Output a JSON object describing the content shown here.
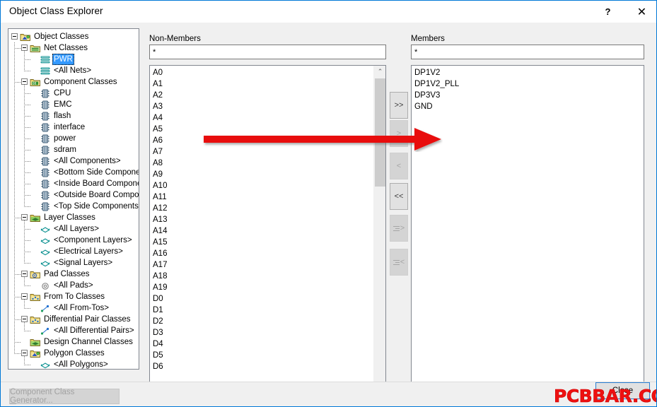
{
  "window": {
    "title": "Object Class Explorer",
    "help_label": "?",
    "close_label": "✕"
  },
  "tree": {
    "name": "object-class-tree",
    "nodes": [
      {
        "label": "Object Classes",
        "depth": 0,
        "icon": "polygon-classes-icon",
        "expander": "minus",
        "selected": false
      },
      {
        "label": "Net Classes",
        "depth": 1,
        "icon": "net-classes-folder-icon",
        "expander": "minus",
        "selected": false
      },
      {
        "label": "PWR",
        "depth": 2,
        "icon": "net-class-icon",
        "expander": "none",
        "selected": true
      },
      {
        "label": "<All Nets>",
        "depth": 2,
        "icon": "net-class-icon",
        "expander": "none",
        "selected": false
      },
      {
        "label": "Component Classes",
        "depth": 1,
        "icon": "component-classes-folder-icon",
        "expander": "minus",
        "selected": false
      },
      {
        "label": "CPU",
        "depth": 2,
        "icon": "component-class-icon",
        "expander": "none",
        "selected": false
      },
      {
        "label": "EMC",
        "depth": 2,
        "icon": "component-class-icon",
        "expander": "none",
        "selected": false
      },
      {
        "label": "flash",
        "depth": 2,
        "icon": "component-class-icon",
        "expander": "none",
        "selected": false
      },
      {
        "label": "interface",
        "depth": 2,
        "icon": "component-class-icon",
        "expander": "none",
        "selected": false
      },
      {
        "label": "power",
        "depth": 2,
        "icon": "component-class-icon",
        "expander": "none",
        "selected": false
      },
      {
        "label": "sdram",
        "depth": 2,
        "icon": "component-class-icon",
        "expander": "none",
        "selected": false
      },
      {
        "label": "<All Components>",
        "depth": 2,
        "icon": "component-class-icon",
        "expander": "none",
        "selected": false
      },
      {
        "label": "<Bottom Side Components>",
        "depth": 2,
        "icon": "component-class-icon",
        "expander": "none",
        "selected": false
      },
      {
        "label": "<Inside Board Components>",
        "depth": 2,
        "icon": "component-class-icon",
        "expander": "none",
        "selected": false
      },
      {
        "label": "<Outside Board Components>",
        "depth": 2,
        "icon": "component-class-icon",
        "expander": "none",
        "selected": false
      },
      {
        "label": "<Top Side Components>",
        "depth": 2,
        "icon": "component-class-icon",
        "expander": "none",
        "selected": false
      },
      {
        "label": "Layer Classes",
        "depth": 1,
        "icon": "layer-classes-folder-icon",
        "expander": "minus",
        "selected": false
      },
      {
        "label": "<All Layers>",
        "depth": 2,
        "icon": "layer-class-icon",
        "expander": "none",
        "selected": false
      },
      {
        "label": "<Component Layers>",
        "depth": 2,
        "icon": "layer-class-icon",
        "expander": "none",
        "selected": false
      },
      {
        "label": "<Electrical Layers>",
        "depth": 2,
        "icon": "layer-class-icon",
        "expander": "none",
        "selected": false
      },
      {
        "label": "<Signal Layers>",
        "depth": 2,
        "icon": "layer-class-icon",
        "expander": "none",
        "selected": false
      },
      {
        "label": "Pad Classes",
        "depth": 1,
        "icon": "pad-classes-folder-icon",
        "expander": "minus",
        "selected": false
      },
      {
        "label": "<All Pads>",
        "depth": 2,
        "icon": "pad-class-icon",
        "expander": "none",
        "selected": false
      },
      {
        "label": "From To Classes",
        "depth": 1,
        "icon": "fromto-classes-folder-icon",
        "expander": "minus",
        "selected": false
      },
      {
        "label": "<All From-Tos>",
        "depth": 2,
        "icon": "fromto-class-icon",
        "expander": "none",
        "selected": false
      },
      {
        "label": "Differential Pair Classes",
        "depth": 1,
        "icon": "diffpair-classes-folder-icon",
        "expander": "minus",
        "selected": false
      },
      {
        "label": "<All Differential Pairs>",
        "depth": 2,
        "icon": "diffpair-class-icon",
        "expander": "none",
        "selected": false
      },
      {
        "label": "Design Channel Classes",
        "depth": 1,
        "icon": "design-channel-folder-icon",
        "expander": "none",
        "selected": false
      },
      {
        "label": "Polygon Classes",
        "depth": 1,
        "icon": "polygon-classes-folder-icon",
        "expander": "minus",
        "selected": false
      },
      {
        "label": "<All Polygons>",
        "depth": 2,
        "icon": "polygon-class-icon",
        "expander": "none",
        "selected": false
      }
    ]
  },
  "non_members": {
    "label": "Non-Members",
    "filter_value": "*",
    "filter_placeholder": "*",
    "items": [
      "A0",
      "A1",
      "A2",
      "A3",
      "A4",
      "A5",
      "A6",
      "A7",
      "A8",
      "A9",
      "A10",
      "A11",
      "A12",
      "A13",
      "A14",
      "A15",
      "A16",
      "A17",
      "A18",
      "A19",
      "D0",
      "D1",
      "D2",
      "D3",
      "D4",
      "D5",
      "D6"
    ],
    "scroll_up_glyph": "⌃",
    "scroll_down_glyph": "⌄"
  },
  "members": {
    "label": "Members",
    "filter_value": "*",
    "filter_placeholder": "*",
    "items": [
      "DP1V2",
      "DP1V2_PLL",
      "DP3V3",
      "GND"
    ]
  },
  "transfer_buttons": [
    {
      "name": "add-all-button",
      "glyph": ">>",
      "lines": false,
      "disabled": false
    },
    {
      "name": "add-selected-button",
      "glyph": ">",
      "lines": false,
      "disabled": true
    },
    {
      "name": "remove-selected-button",
      "glyph": "<",
      "lines": false,
      "disabled": true
    },
    {
      "name": "remove-all-button",
      "glyph": "<<",
      "lines": false,
      "disabled": false
    },
    {
      "name": "add-listed-button",
      "glyph": ">",
      "lines": true,
      "disabled": true
    },
    {
      "name": "remove-listed-button",
      "glyph": "<",
      "lines": true,
      "disabled": true
    }
  ],
  "footer": {
    "generator_label_pre": "Component Class ",
    "generator_label_accel": "G",
    "generator_label_post": "enerator...",
    "close_label": "Close"
  },
  "watermark": {
    "text": "PCBBAR.COM",
    "color": "#ee1111"
  },
  "annotation": {
    "arrow_color": "#e81010",
    "description": "red-arrow-pointing-right"
  }
}
